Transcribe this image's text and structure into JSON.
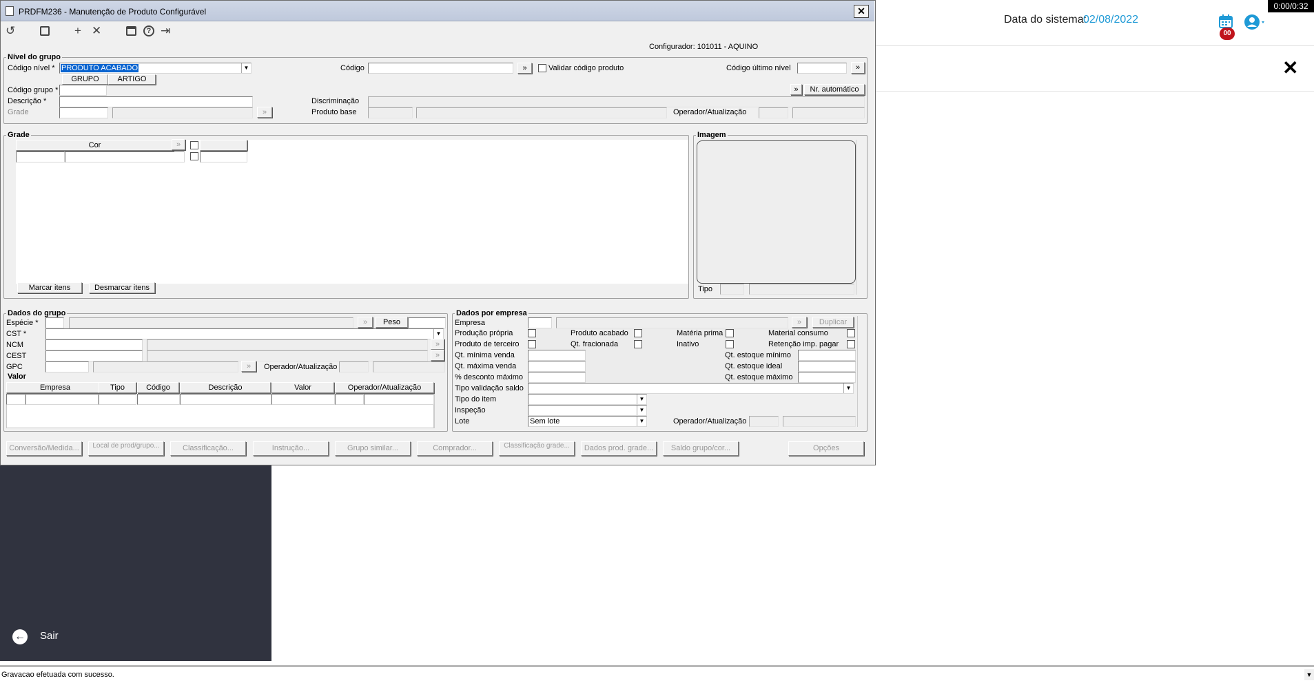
{
  "overlay": {
    "timer": "0:00/0:32"
  },
  "topbar": {
    "system_date_label": "Data do sistema:",
    "system_date_value": "02/08/2022",
    "notification_badge": "00"
  },
  "sidebar": {
    "exit_label": "Sair"
  },
  "status": {
    "message": "Gravacao efetuada com sucesso."
  },
  "window": {
    "title": "PRDFM236 - Manutenção de Produto Configurável",
    "configurator": "Configurador: 101011 - AQUINO",
    "nivel": {
      "title": "Nível do grupo",
      "codigo_nivel_label": "Código nível *",
      "codigo_nivel_value": "PRODUTO ACABADO",
      "grupo_btn": "GRUPO",
      "artigo_btn": "ARTIGO",
      "codigo_label": "Código",
      "codigo_go": "»",
      "validar_label": "Validar código produto",
      "codigo_ultimo_label": "Código último nível",
      "codigo_grupo_label": "Código grupo *",
      "nr_auto_go": "»",
      "nr_auto_btn": "Nr. automático",
      "descricao_label": "Descrição *",
      "discriminacao_label": "Discriminação",
      "grade_label": "Grade",
      "produto_base_label": "Produto base",
      "operador_label": "Operador/Atualização"
    },
    "grade": {
      "title": "Grade",
      "cor_header": "Cor",
      "marcar_btn": "Marcar itens",
      "desmarcar_btn": "Desmarcar itens"
    },
    "imagem": {
      "title": "Imagem",
      "tipo_label": "Tipo"
    },
    "dados_grupo": {
      "title": "Dados do grupo",
      "especie_label": "Espécie *",
      "peso_btn": "Peso",
      "cst_label": "CST *",
      "ncm_label": "NCM",
      "cest_label": "CEST",
      "gpc_label": "GPC",
      "operador_label": "Operador/Atualização",
      "valor_title": "Valor",
      "valor_headers": [
        "Empresa",
        "Tipo",
        "Código",
        "Descrição",
        "Valor",
        "Operador/Atualização"
      ]
    },
    "dados_empresa": {
      "title": "Dados por empresa",
      "empresa_label": "Empresa",
      "duplicar_btn": "Duplicar",
      "producao_propria": "Produção própria",
      "produto_acabado": "Produto acabado",
      "materia_prima": "Matéria prima",
      "material_consumo": "Material consumo",
      "produto_terceiro": "Produto de terceiro",
      "qt_fracionada": "Qt. fracionada",
      "inativo": "Inativo",
      "retencao": "Retenção imp. pagar",
      "qt_min_venda": "Qt. mínima venda",
      "qt_max_venda": "Qt. máxima venda",
      "desconto_max": "% desconto máximo",
      "qt_estoque_min": "Qt. estoque mínimo",
      "qt_estoque_ideal": "Qt. estoque ideal",
      "qt_estoque_max": "Qt. estoque máximo",
      "tipo_validacao": "Tipo validação saldo",
      "tipo_item": "Tipo do item",
      "inspecao": "Inspeção",
      "lote_label": "Lote",
      "lote_value": "Sem lote",
      "operador_label": "Operador/Atualização"
    },
    "footer_buttons": [
      "Conversão/Medida...",
      "Local de prod/grupo...",
      "Classificação...",
      "Instrução...",
      "Grupo similar...",
      "Comprador...",
      "Classificação grade...",
      "Dados prod. grade...",
      "Saldo grupo/cor..."
    ],
    "options_btn": "Opções"
  }
}
